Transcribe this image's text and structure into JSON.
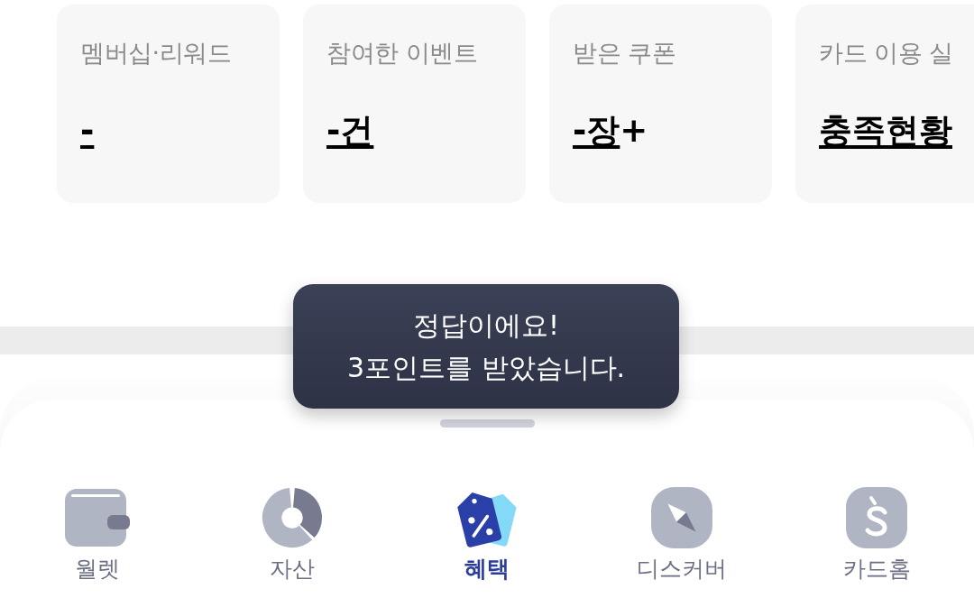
{
  "summary_cards": [
    {
      "label": "멤버십·리워드",
      "value": "-"
    },
    {
      "label": "참여한 이벤트",
      "value": "-건"
    },
    {
      "label": "받은 쿠폰",
      "value": "-장",
      "suffix": "+"
    },
    {
      "label": "카드 이용 실",
      "value": "충족현황"
    }
  ],
  "toast": {
    "message": "정답이에요!\n3포인트를 받았습니다."
  },
  "bottom_nav": [
    {
      "label": "월렛",
      "selected": false
    },
    {
      "label": "자산",
      "selected": false
    },
    {
      "label": "혜택",
      "selected": true
    },
    {
      "label": "디스커버",
      "selected": false
    },
    {
      "label": "카드홈",
      "selected": false
    }
  ]
}
